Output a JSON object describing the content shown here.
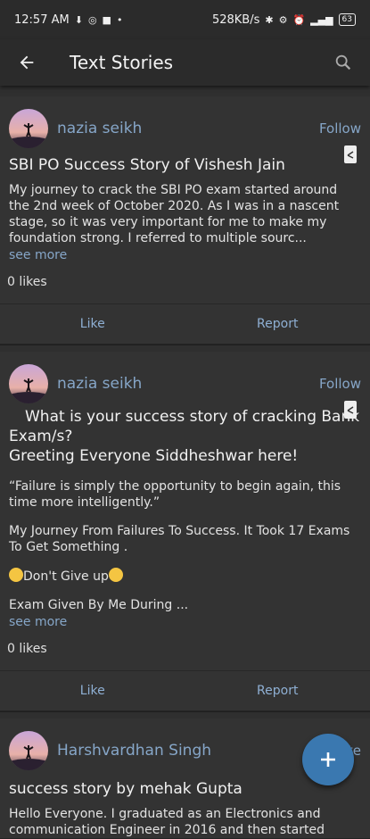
{
  "status_bar": {
    "time": "12:57 AM",
    "speed": "528KB/s",
    "battery": "63"
  },
  "appbar": {
    "title": "Text Stories"
  },
  "posts": [
    {
      "author": "nazia seikh",
      "action": "Follow",
      "title": "SBI PO Success Story of Vishesh Jain",
      "body": "My journey to crack the SBI PO exam started around the 2nd week of October 2020. As I was in a nascent stage, so it was very important for me to make my foundation strong. I referred to multiple sourc...",
      "see_more": "see more",
      "likes": "0 likes",
      "like_label": "Like",
      "report_label": "Report"
    },
    {
      "author": "nazia seikh",
      "action": "Follow",
      "title": "What is your success story of cracking Bank Exam/s?",
      "greeting": "Greeting Everyone Siddheshwar here!",
      "quote": "“Failure is simply the opportunity to begin again, this time more intelligently.”",
      "journey": "My Journey From Failures To Success. It Took 17 Exams To Get Something .",
      "dont_give_up": "Don't Give up",
      "exam_given": "Exam Given By Me During ...",
      "see_more": "see more",
      "likes": "0 likes",
      "like_label": "Like",
      "report_label": "Report"
    },
    {
      "author": "Harshvardhan Singh",
      "action": "Delete",
      "title": "success story by mehak Gupta",
      "body": "Hello Everyone. I graduated as an Electronics and communication Engineer in 2016 and then started"
    }
  ],
  "fab": {
    "icon": "plus-icon"
  },
  "colors": {
    "accent": "#86a6c8",
    "fab": "#3a78b0",
    "background": "#2f2f2f"
  }
}
